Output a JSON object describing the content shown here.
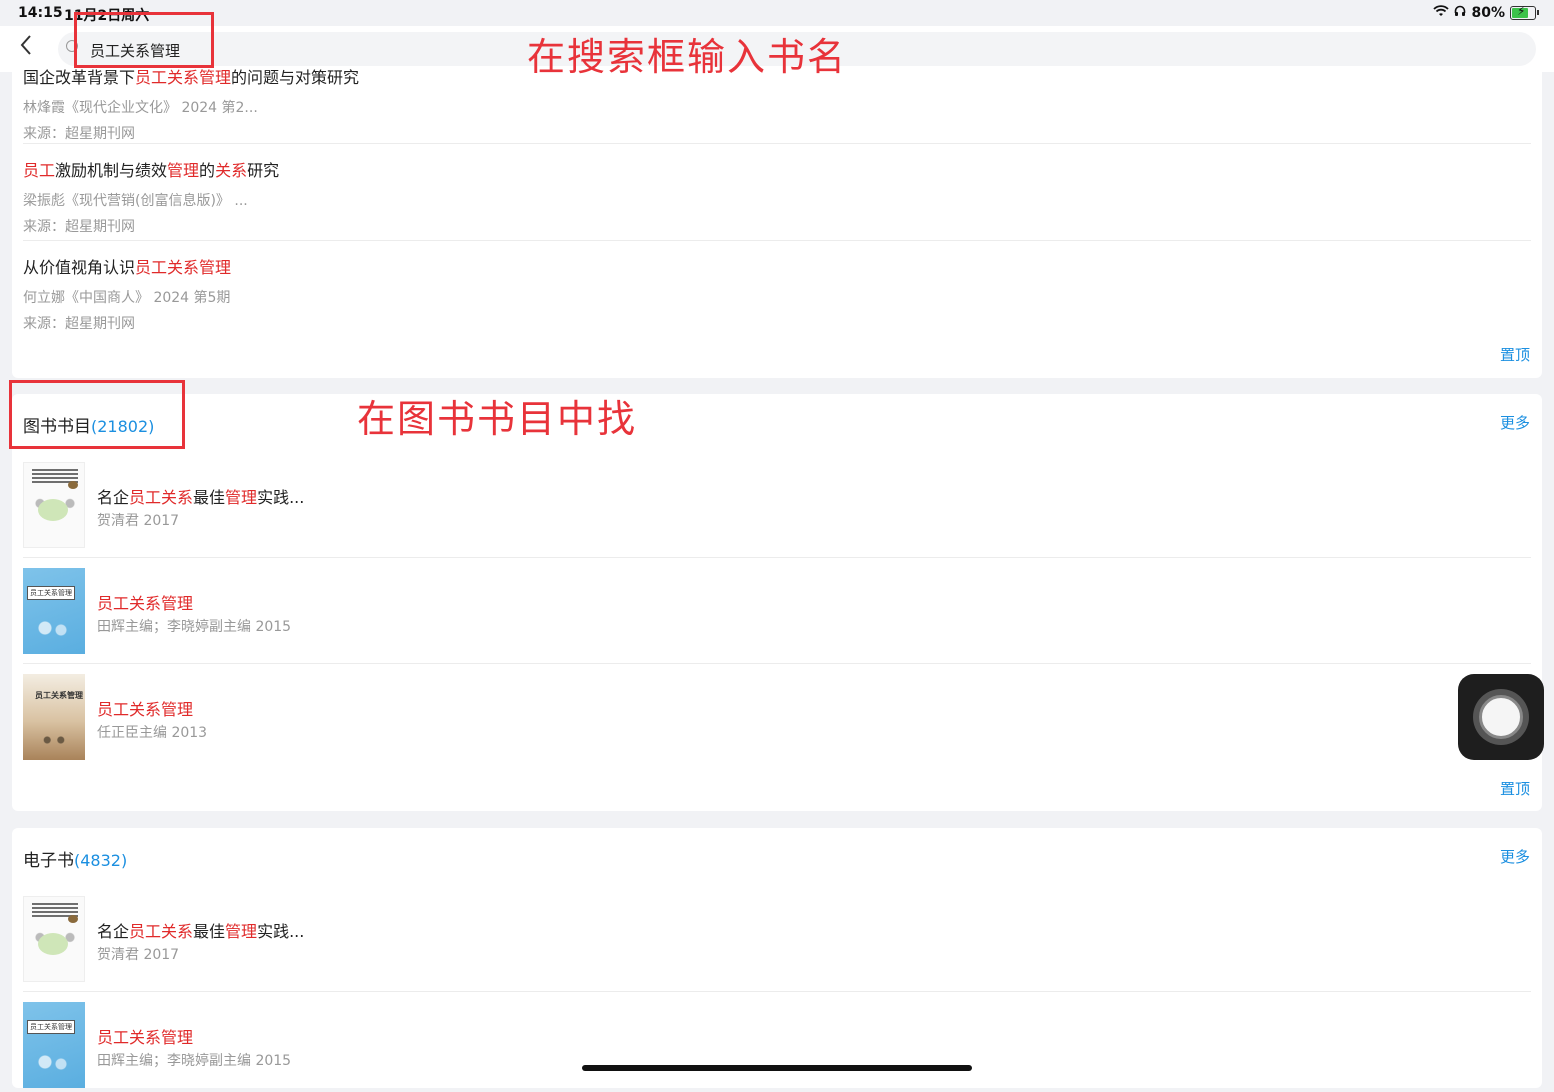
{
  "status": {
    "time": "14:15",
    "date": "11月2日周六",
    "battery": "80%",
    "battery_level": 0.8
  },
  "search": {
    "value": "员工关系管理"
  },
  "annotations": {
    "search_hint": "在搜索框输入书名",
    "books_hint": "在图书书目中找"
  },
  "articles": [
    {
      "title_parts": [
        [
          "",
          "国企改革背景下"
        ],
        [
          "hl",
          "员工关系管理"
        ],
        [
          "",
          "的问题与对策研究"
        ]
      ],
      "meta": "林烽霞《现代企业文化》 2024 第2...",
      "source": "来源：超星期刊网"
    },
    {
      "title_parts": [
        [
          "hl",
          "员工"
        ],
        [
          "",
          "激励机制与绩效"
        ],
        [
          "hl",
          "管理"
        ],
        [
          "",
          "的"
        ],
        [
          "hl",
          "关系"
        ],
        [
          "",
          "研究"
        ]
      ],
      "meta": "梁振彪《现代营销(创富信息版)》 ...",
      "source": "来源：超星期刊网"
    },
    {
      "title_parts": [
        [
          "",
          "从价值视角认识"
        ],
        [
          "hl",
          "员工关系管理"
        ]
      ],
      "meta": "何立娜《中国商人》 2024 第5期",
      "source": "来源：超星期刊网"
    }
  ],
  "labels": {
    "pin": "置顶",
    "more": "更多"
  },
  "books_section": {
    "title": "图书书目",
    "count": "(21802)",
    "items": [
      {
        "title_parts": [
          [
            "",
            "名企"
          ],
          [
            "hl",
            "员工关系"
          ],
          [
            "",
            "最佳"
          ],
          [
            "hl",
            "管理"
          ],
          [
            "",
            "实践..."
          ]
        ],
        "meta": "贺清君   2017",
        "cover": "white"
      },
      {
        "title_parts": [
          [
            "hl",
            "员工关系管理"
          ]
        ],
        "meta": "田辉主编；李晓婷副主编   2015",
        "cover": "blue"
      },
      {
        "title_parts": [
          [
            "hl",
            "员工关系管理"
          ]
        ],
        "meta": "任正臣主编   2013",
        "cover": "brown"
      }
    ]
  },
  "ebooks_section": {
    "title": "电子书",
    "count": "(4832)",
    "items": [
      {
        "title_parts": [
          [
            "",
            "名企"
          ],
          [
            "hl",
            "员工关系"
          ],
          [
            "",
            "最佳"
          ],
          [
            "hl",
            "管理"
          ],
          [
            "",
            "实践..."
          ]
        ],
        "meta": "贺清君   2017",
        "cover": "white"
      },
      {
        "title_parts": [
          [
            "hl",
            "员工关系管理"
          ]
        ],
        "meta": "田辉主编；李晓婷副主编   2015",
        "cover": "blue"
      }
    ]
  },
  "covers": {
    "blue_label": "员工关系管理",
    "brown_label": "员工关系管理"
  },
  "colors": {
    "highlight": "#e02a2a",
    "link": "#1b8fe0",
    "annotation": "#e8333a"
  }
}
